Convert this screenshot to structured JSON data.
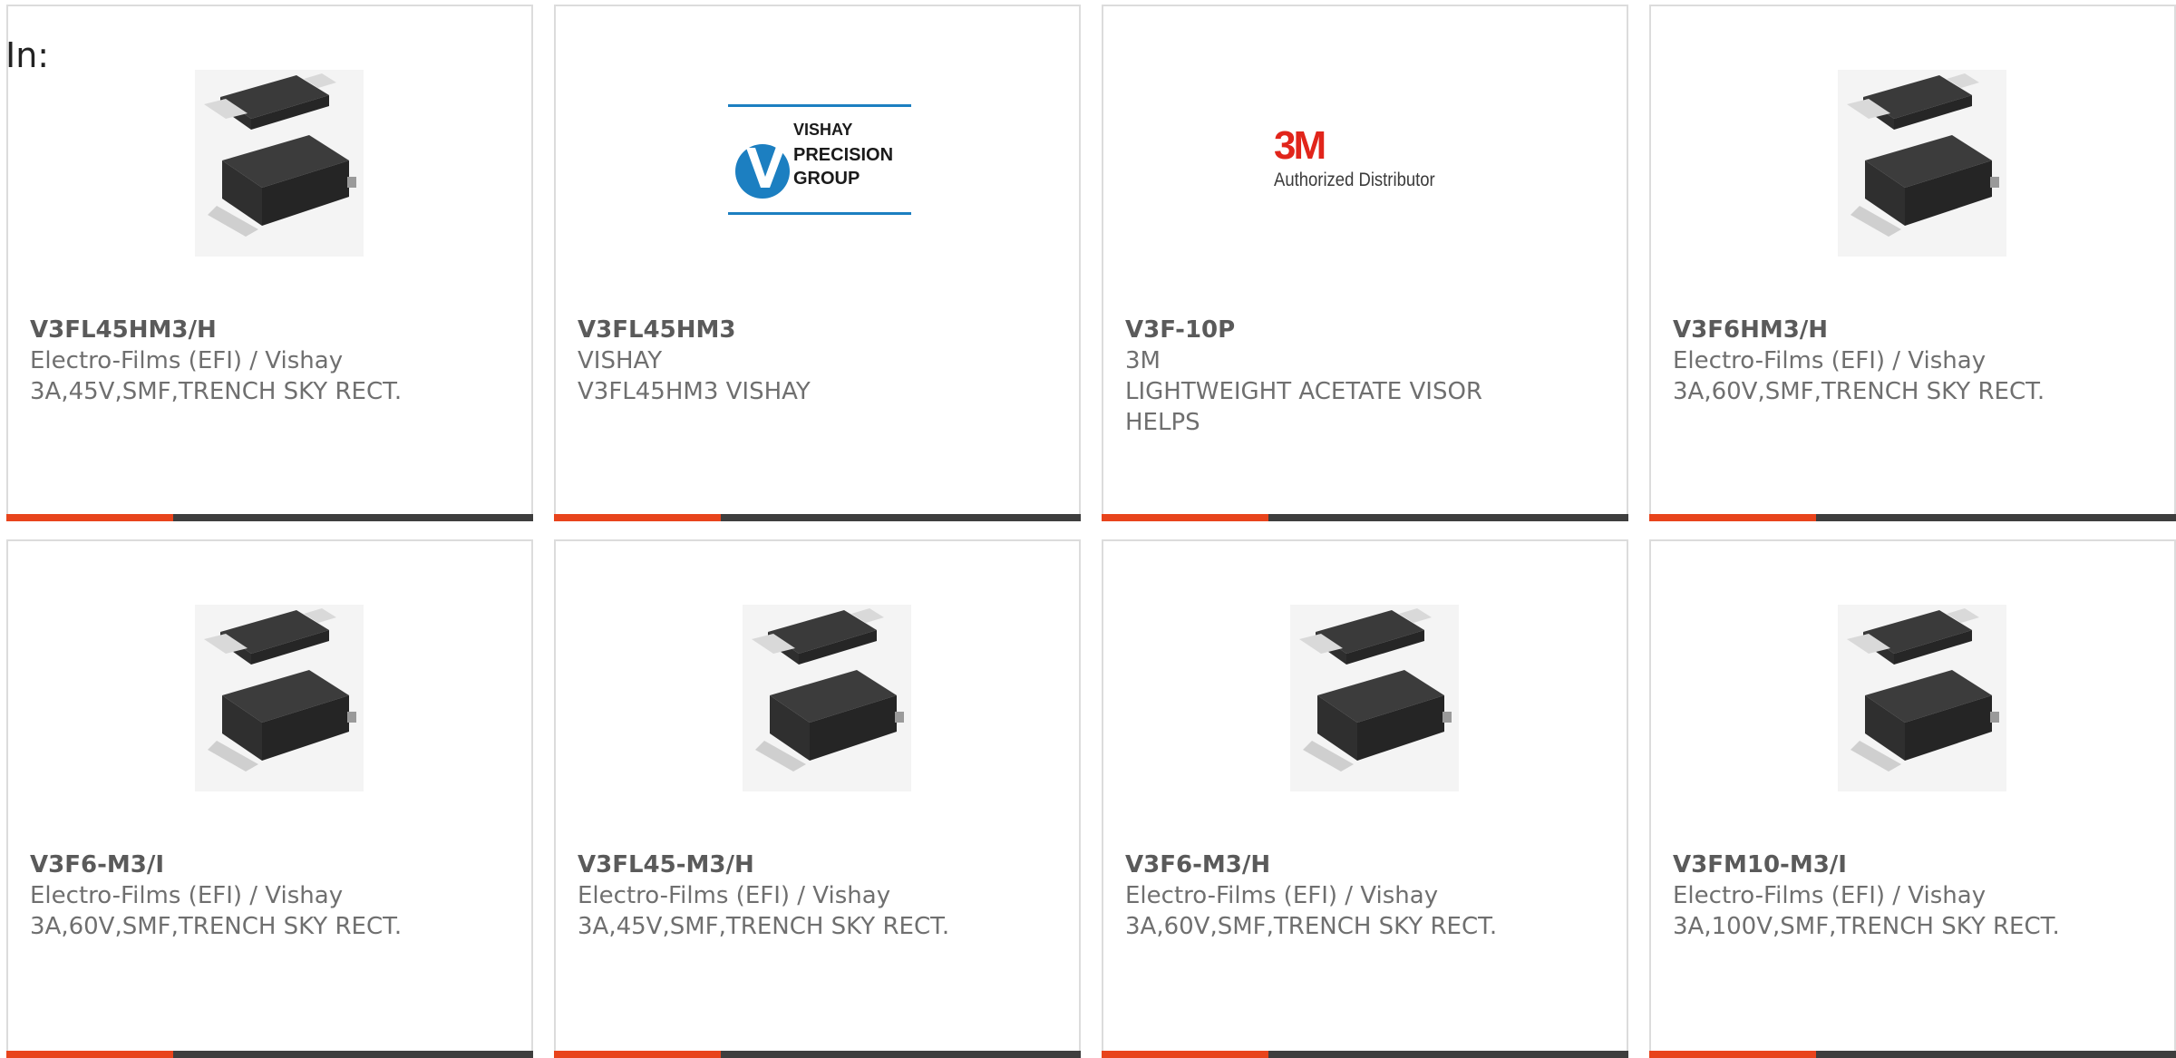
{
  "search": {
    "label": "In:"
  },
  "cards": [
    {
      "image": "diode-package-image",
      "part_number": "V3FL45HM3/H",
      "manufacturer": "Electro-Films (EFI) / Vishay",
      "description": "3A,45V,SMF,TRENCH SKY RECT."
    },
    {
      "image": "vishay-precision-group-logo",
      "logo_text": [
        "VISHAY",
        "PRECISION",
        "GROUP"
      ],
      "part_number": "V3FL45HM3",
      "manufacturer": "VISHAY",
      "description": "V3FL45HM3 VISHAY"
    },
    {
      "image": "3m-authorized-distributor-logo",
      "logo_mark": "3M",
      "logo_caption": "Authorized Distributor",
      "part_number": "V3F-10P",
      "manufacturer": "3M",
      "description": "LIGHTWEIGHT ACETATE VISOR HELPS"
    },
    {
      "image": "diode-package-image",
      "part_number": "V3F6HM3/H",
      "manufacturer": "Electro-Films (EFI) / Vishay",
      "description": "3A,60V,SMF,TRENCH SKY RECT."
    },
    {
      "image": "diode-package-image",
      "part_number": "V3F6-M3/I",
      "manufacturer": "Electro-Films (EFI) / Vishay",
      "description": "3A,60V,SMF,TRENCH SKY RECT."
    },
    {
      "image": "diode-package-image",
      "part_number": "V3FL45-M3/H",
      "manufacturer": "Electro-Films (EFI) / Vishay",
      "description": "3A,45V,SMF,TRENCH SKY RECT."
    },
    {
      "image": "diode-package-image",
      "part_number": "V3F6-M3/H",
      "manufacturer": "Electro-Films (EFI) / Vishay",
      "description": "3A,60V,SMF,TRENCH SKY RECT."
    },
    {
      "image": "diode-package-image",
      "part_number": "V3FM10-M3/I",
      "manufacturer": "Electro-Films (EFI) / Vishay",
      "description": "3A,100V,SMF,TRENCH SKY RECT."
    }
  ],
  "colors": {
    "accent": "#e8441c",
    "bar": "#3e3e3e",
    "border": "#dcdcdc",
    "text": "#6f6f6f",
    "vishay_blue": "#1c7fc1",
    "threem_red": "#e1251b"
  }
}
